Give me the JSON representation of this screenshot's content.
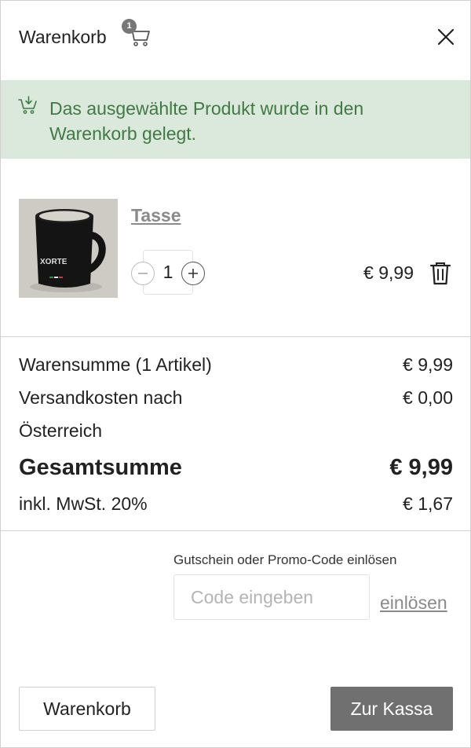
{
  "header": {
    "title": "Warenkorb",
    "cart_count": "1",
    "cart_icon": "shopping-cart-icon",
    "close_icon": "close-icon"
  },
  "notice": {
    "icon": "cart-add-icon",
    "message": "Das ausgewählte Produkt wurde in den Warenkorb gelegt.",
    "color": "#3f7a43",
    "background": "#dbe9dc"
  },
  "items": [
    {
      "name": "Tasse",
      "image_text": "XORTE",
      "quantity": "1",
      "price": "€ 9,99",
      "delete_icon": "trash-icon"
    }
  ],
  "totals": {
    "subtotal_label": "Warensumme (1 Artikel)",
    "subtotal_value": "€ 9,99",
    "shipping_label_1": "Versandkosten nach",
    "shipping_label_2": "Österreich",
    "shipping_value": "€ 0,00",
    "total_label": "Gesamtsumme",
    "total_value": "€ 9,99",
    "vat_label": "inkl. MwSt. 20%",
    "vat_value": "€ 1,67"
  },
  "coupon": {
    "label": "Gutschein oder Promo-Code einlösen",
    "placeholder": "Code eingeben",
    "value": "",
    "redeem_label": "einlösen"
  },
  "actions": {
    "cart_label": "Warenkorb",
    "checkout_label": "Zur Kassa",
    "checkout_color": "#707070"
  }
}
